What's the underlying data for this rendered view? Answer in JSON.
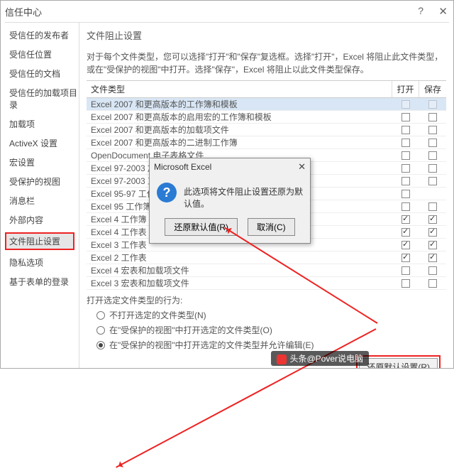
{
  "window": {
    "title": "信任中心"
  },
  "sidebar": {
    "items": [
      "受信任的发布者",
      "受信任位置",
      "受信任的文档",
      "受信任的加载项目录",
      "加载项",
      "ActiveX 设置",
      "宏设置",
      "受保护的视图",
      "消息栏",
      "外部内容",
      "文件阻止设置",
      "隐私选项",
      "基于表单的登录"
    ],
    "selected_index": 10
  },
  "main": {
    "heading": "文件阻止设置",
    "desc": "对于每个文件类型，您可以选择\"打开\"和\"保存\"复选框。选择\"打开\"，Excel 将阻止此文件类型，或在\"受保护的视图\"中打开。选择\"保存\"，Excel 将阻止以此文件类型保存。",
    "col_type": "文件类型",
    "col_open": "打开",
    "col_save": "保存",
    "rows": [
      {
        "label": "Excel 2007 和更高版本的工作簿和模板",
        "open": false,
        "save": false,
        "hl": true,
        "dim": true
      },
      {
        "label": "Excel 2007 和更高版本的启用宏的工作簿和模板",
        "open": false,
        "save": false
      },
      {
        "label": "Excel 2007 和更高版本的加载项文件",
        "open": false,
        "save": false
      },
      {
        "label": "Excel 2007 和更高版本的二进制工作簿",
        "open": false,
        "save": false
      },
      {
        "label": "OpenDocument 电子表格文件",
        "open": false,
        "save": false
      },
      {
        "label": "Excel 97-2003 加载项文件",
        "open": false,
        "save": false
      },
      {
        "label": "Excel 97-2003 工作簿和模板",
        "open": false,
        "save": false
      },
      {
        "label": "Excel 95-97 工作簿和模板",
        "open": false,
        "save": false,
        "no_save": true
      },
      {
        "label": "Excel 95 工作簿",
        "open": false,
        "save": false
      },
      {
        "label": "Excel 4 工作簿",
        "open": true,
        "save": true
      },
      {
        "label": "Excel 4 工作表",
        "open": true,
        "save": true
      },
      {
        "label": "Excel 3 工作表",
        "open": true,
        "save": true
      },
      {
        "label": "Excel 2 工作表",
        "open": true,
        "save": true
      },
      {
        "label": "Excel 4 宏表和加载项文件",
        "open": false,
        "save": false
      },
      {
        "label": "Excel 3 宏表和加载项文件",
        "open": false,
        "save": false
      }
    ],
    "behavior_label": "打开选定文件类型的行为:",
    "radios": [
      {
        "text": "不打开选定的文件类型(N)",
        "sel": false
      },
      {
        "text": "在\"受保护的视图\"中打开选定的文件类型(O)",
        "sel": false
      },
      {
        "text": "在\"受保护的视图\"中打开选定的文件类型并允许编辑(E)",
        "sel": true
      }
    ],
    "restore_btn": "还原默认设置(R)"
  },
  "dialog": {
    "title": "Microsoft Excel",
    "message": "此选项将文件阻止设置还原为默认值。",
    "ok": "还原默认值(R)",
    "cancel": "取消(C)"
  },
  "watermark": "头条@Pover说电脑"
}
